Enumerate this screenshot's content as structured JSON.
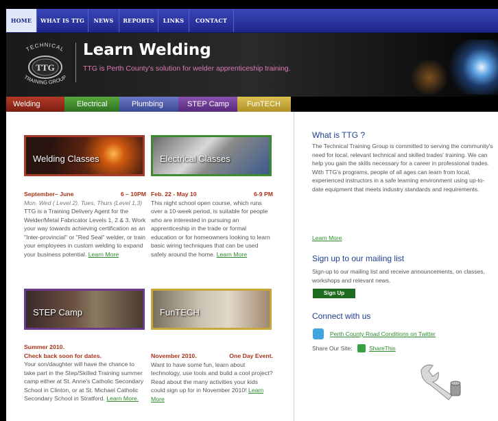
{
  "topnav": {
    "items": [
      {
        "label": "HOME",
        "active": true
      },
      {
        "label": "WHAT IS TTG"
      },
      {
        "label": "NEWS"
      },
      {
        "label": "REPORTS"
      },
      {
        "label": "LINKS"
      },
      {
        "label": "CONTACT"
      }
    ]
  },
  "banner": {
    "logo_top": "TECHNICAL",
    "logo_mid": "TTG",
    "logo_bottom": "TRAINING GROUP",
    "title": "Learn Welding",
    "tagline": "TTG is Perth County's solution for welder apprenticeship training."
  },
  "subnav": {
    "tabs": [
      {
        "label": "Welding",
        "color": "#9a2a1e"
      },
      {
        "label": "Electrical",
        "color": "#3e8a2e"
      },
      {
        "label": "Plumbing",
        "color": "#4a5aa8"
      },
      {
        "label": "STEP Camp",
        "color": "#6a3a8e"
      },
      {
        "label": "FunTECH",
        "color": "#c8a83a"
      }
    ]
  },
  "programs": {
    "welding": {
      "thumb": "Welding Classes",
      "date": "September– June",
      "time": "6 – 10PM",
      "schedule": "Mon. Wed ( Level 2), Tues, Thurs (Level 1,3)",
      "body": "TTG is a Training Delivery Agent for the Welder/Metal Fabricator Levels 1, 2 & 3. Work your way towards achieving certification as an \"Inter-provincial\" or \"Red Seal\" welder, or train your employees in custom welding to expand your business potential.",
      "link": "Learn More"
    },
    "electrical": {
      "thumb": "Electrical Classes",
      "date": "Feb. 22 - May 10",
      "time": "6-9 PM",
      "body": "This night school open course, which runs over a 10-week period, is suitable for people who are interested in pursuing an apprenticeship in the trade or formal education or for homeowners looking to learn basic wiring techniques that can be used safely around the home.",
      "link": "Learn More"
    },
    "step": {
      "thumb": "STEP Camp",
      "date": "Summer 2010.",
      "note": "Check back soon for dates.",
      "body": "Your son/daughter will have the chance to take part in the Step/Skilled Training summer camp either at St. Anne's Catholic Secondary School in Clinton, or at St. Michael Catholic Secondary School in Stratford.",
      "link": "Learn More."
    },
    "funtech": {
      "thumb": "FunTECH",
      "date": "November 2010.",
      "note": "One Day Event.",
      "body": "Want to have some fun, learn about technology, use tools and build a cool project? Read about the many activities your kids could sign up for in November 2010!",
      "link": "Learn More"
    }
  },
  "sidebar": {
    "what_title": "What is TTG ?",
    "what_body": "The Technical Training Group is committed to serving the community's need for local, relevant technical and skilled trades' training. We can help you gain the skills necessary for a career in professional trades. With TTG's programs, people of all ages can learn from local, experienced instructors in a safe learning environment using up-to-date equipment that meets industry standards and requirements.",
    "what_link": "Learn More",
    "mail_title": "Sign up to our mailing list",
    "mail_body": "Sign-up to our mailing list and receive announcements, on classes, workshops and relevant news.",
    "signup_label": "Sign Up",
    "connect_title": "Connect with us",
    "twitter_link": "Perth County Road Conditions on Twitter",
    "share_label": "Share Our Site:",
    "share_link": "ShareThis"
  }
}
